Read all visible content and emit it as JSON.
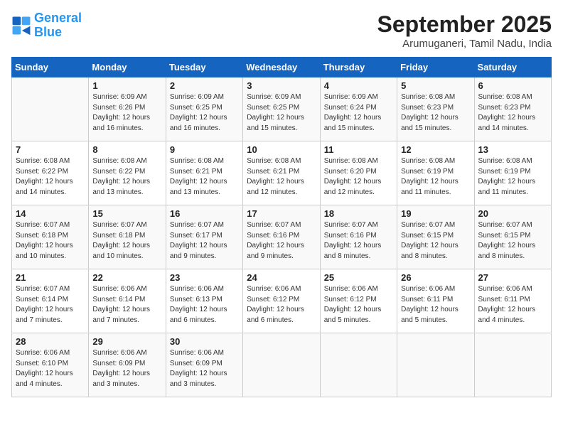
{
  "logo": {
    "line1": "General",
    "line2": "Blue"
  },
  "title": "September 2025",
  "location": "Arumuganeri, Tamil Nadu, India",
  "weekdays": [
    "Sunday",
    "Monday",
    "Tuesday",
    "Wednesday",
    "Thursday",
    "Friday",
    "Saturday"
  ],
  "weeks": [
    [
      {
        "num": "",
        "info": ""
      },
      {
        "num": "1",
        "info": "Sunrise: 6:09 AM\nSunset: 6:26 PM\nDaylight: 12 hours\nand 16 minutes."
      },
      {
        "num": "2",
        "info": "Sunrise: 6:09 AM\nSunset: 6:25 PM\nDaylight: 12 hours\nand 16 minutes."
      },
      {
        "num": "3",
        "info": "Sunrise: 6:09 AM\nSunset: 6:25 PM\nDaylight: 12 hours\nand 15 minutes."
      },
      {
        "num": "4",
        "info": "Sunrise: 6:09 AM\nSunset: 6:24 PM\nDaylight: 12 hours\nand 15 minutes."
      },
      {
        "num": "5",
        "info": "Sunrise: 6:08 AM\nSunset: 6:23 PM\nDaylight: 12 hours\nand 15 minutes."
      },
      {
        "num": "6",
        "info": "Sunrise: 6:08 AM\nSunset: 6:23 PM\nDaylight: 12 hours\nand 14 minutes."
      }
    ],
    [
      {
        "num": "7",
        "info": "Sunrise: 6:08 AM\nSunset: 6:22 PM\nDaylight: 12 hours\nand 14 minutes."
      },
      {
        "num": "8",
        "info": "Sunrise: 6:08 AM\nSunset: 6:22 PM\nDaylight: 12 hours\nand 13 minutes."
      },
      {
        "num": "9",
        "info": "Sunrise: 6:08 AM\nSunset: 6:21 PM\nDaylight: 12 hours\nand 13 minutes."
      },
      {
        "num": "10",
        "info": "Sunrise: 6:08 AM\nSunset: 6:21 PM\nDaylight: 12 hours\nand 12 minutes."
      },
      {
        "num": "11",
        "info": "Sunrise: 6:08 AM\nSunset: 6:20 PM\nDaylight: 12 hours\nand 12 minutes."
      },
      {
        "num": "12",
        "info": "Sunrise: 6:08 AM\nSunset: 6:19 PM\nDaylight: 12 hours\nand 11 minutes."
      },
      {
        "num": "13",
        "info": "Sunrise: 6:08 AM\nSunset: 6:19 PM\nDaylight: 12 hours\nand 11 minutes."
      }
    ],
    [
      {
        "num": "14",
        "info": "Sunrise: 6:07 AM\nSunset: 6:18 PM\nDaylight: 12 hours\nand 10 minutes."
      },
      {
        "num": "15",
        "info": "Sunrise: 6:07 AM\nSunset: 6:18 PM\nDaylight: 12 hours\nand 10 minutes."
      },
      {
        "num": "16",
        "info": "Sunrise: 6:07 AM\nSunset: 6:17 PM\nDaylight: 12 hours\nand 9 minutes."
      },
      {
        "num": "17",
        "info": "Sunrise: 6:07 AM\nSunset: 6:16 PM\nDaylight: 12 hours\nand 9 minutes."
      },
      {
        "num": "18",
        "info": "Sunrise: 6:07 AM\nSunset: 6:16 PM\nDaylight: 12 hours\nand 8 minutes."
      },
      {
        "num": "19",
        "info": "Sunrise: 6:07 AM\nSunset: 6:15 PM\nDaylight: 12 hours\nand 8 minutes."
      },
      {
        "num": "20",
        "info": "Sunrise: 6:07 AM\nSunset: 6:15 PM\nDaylight: 12 hours\nand 8 minutes."
      }
    ],
    [
      {
        "num": "21",
        "info": "Sunrise: 6:07 AM\nSunset: 6:14 PM\nDaylight: 12 hours\nand 7 minutes."
      },
      {
        "num": "22",
        "info": "Sunrise: 6:06 AM\nSunset: 6:14 PM\nDaylight: 12 hours\nand 7 minutes."
      },
      {
        "num": "23",
        "info": "Sunrise: 6:06 AM\nSunset: 6:13 PM\nDaylight: 12 hours\nand 6 minutes."
      },
      {
        "num": "24",
        "info": "Sunrise: 6:06 AM\nSunset: 6:12 PM\nDaylight: 12 hours\nand 6 minutes."
      },
      {
        "num": "25",
        "info": "Sunrise: 6:06 AM\nSunset: 6:12 PM\nDaylight: 12 hours\nand 5 minutes."
      },
      {
        "num": "26",
        "info": "Sunrise: 6:06 AM\nSunset: 6:11 PM\nDaylight: 12 hours\nand 5 minutes."
      },
      {
        "num": "27",
        "info": "Sunrise: 6:06 AM\nSunset: 6:11 PM\nDaylight: 12 hours\nand 4 minutes."
      }
    ],
    [
      {
        "num": "28",
        "info": "Sunrise: 6:06 AM\nSunset: 6:10 PM\nDaylight: 12 hours\nand 4 minutes."
      },
      {
        "num": "29",
        "info": "Sunrise: 6:06 AM\nSunset: 6:09 PM\nDaylight: 12 hours\nand 3 minutes."
      },
      {
        "num": "30",
        "info": "Sunrise: 6:06 AM\nSunset: 6:09 PM\nDaylight: 12 hours\nand 3 minutes."
      },
      {
        "num": "",
        "info": ""
      },
      {
        "num": "",
        "info": ""
      },
      {
        "num": "",
        "info": ""
      },
      {
        "num": "",
        "info": ""
      }
    ]
  ]
}
